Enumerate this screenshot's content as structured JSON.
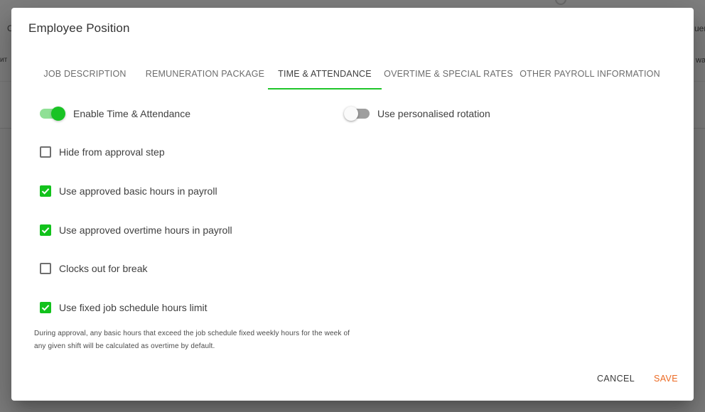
{
  "background": {
    "fragments": [
      "C",
      "uer",
      "ит",
      "wa"
    ]
  },
  "dialog": {
    "title": "Employee Position",
    "tabs": [
      {
        "label": "JOB DESCRIPTION"
      },
      {
        "label": "REMUNERATION PACKAGE"
      },
      {
        "label": "TIME & ATTENDANCE"
      },
      {
        "label": "OVERTIME & SPECIAL RATES"
      },
      {
        "label": "OTHER PAYROLL INFORMATION"
      }
    ],
    "active_tab": "TIME & ATTENDANCE",
    "toggles": [
      {
        "label": "Enable Time & Attendance",
        "checked": true
      },
      {
        "label": "Use personalised rotation",
        "checked": false
      }
    ],
    "checkboxes": [
      {
        "label": "Hide from approval step",
        "checked": false
      },
      {
        "label": "Use approved basic hours in payroll",
        "checked": true
      },
      {
        "label": "Use approved overtime hours in payroll",
        "checked": true
      },
      {
        "label": "Clocks out for break",
        "checked": false
      },
      {
        "label": "Use fixed job schedule hours limit",
        "checked": true
      }
    ],
    "helper_text": "During approval, any basic hours that exceed the job schedule fixed weekly hours for the week of any given shift will be calculated as overtime by default.",
    "actions": {
      "cancel": "CANCEL",
      "save": "SAVE"
    }
  },
  "colors": {
    "accent_green": "#19c324",
    "save_orange": "#ec6a23",
    "overlay": "#7d7d7d"
  }
}
